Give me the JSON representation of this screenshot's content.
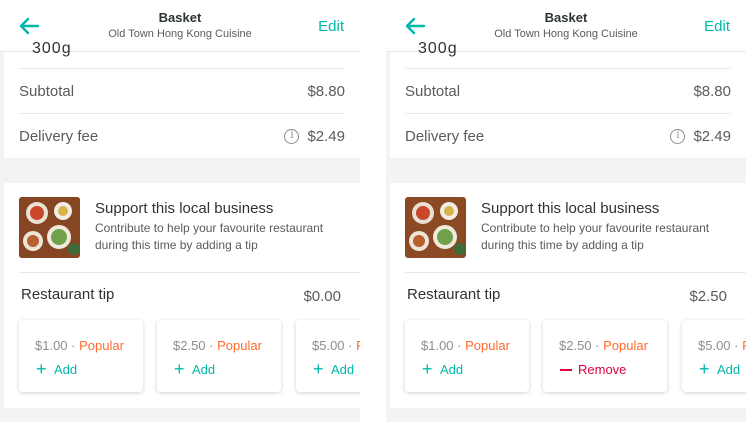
{
  "screens": [
    {
      "header": {
        "title": "Basket",
        "subtitle": "Old Town Hong Kong Cuisine",
        "edit_label": "Edit"
      },
      "summary": {
        "cutoff_text": "300g",
        "subtotal_label": "Subtotal",
        "subtotal_value": "$8.80",
        "delivery_label": "Delivery fee",
        "delivery_value": "$2.49",
        "info_icon": "i"
      },
      "support": {
        "title": "Support this local business",
        "description": "Contribute to help your favourite restaurant during this time by adding a tip",
        "tip_label": "Restaurant tip",
        "tip_amount": "$0.00",
        "options": [
          {
            "price": "$1.00 · ",
            "popular": "Popular",
            "action": "Add",
            "state": "add"
          },
          {
            "price": "$2.50 · ",
            "popular": "Popular",
            "action": "Add",
            "state": "add"
          },
          {
            "price": "$5.00 · ",
            "popular": "P",
            "action": "Add",
            "state": "add"
          }
        ]
      }
    },
    {
      "header": {
        "title": "Basket",
        "subtitle": "Old Town Hong Kong Cuisine",
        "edit_label": "Edit"
      },
      "summary": {
        "cutoff_text": "300g",
        "subtotal_label": "Subtotal",
        "subtotal_value": "$8.80",
        "delivery_label": "Delivery fee",
        "delivery_value": "$2.49",
        "info_icon": "i"
      },
      "support": {
        "title": "Support this local business",
        "description": "Contribute to help your favourite restaurant during this time by adding a tip",
        "tip_label": "Restaurant tip",
        "tip_amount": "$2.50",
        "options": [
          {
            "price": "$1.00 · ",
            "popular": "Popular",
            "action": "Add",
            "state": "add"
          },
          {
            "price": "$2.50 · ",
            "popular": "Popular",
            "action": "Remove",
            "state": "remove"
          },
          {
            "price": "$5.00 · ",
            "popular": "P",
            "action": "Add",
            "state": "add"
          }
        ]
      }
    }
  ],
  "colors": {
    "teal": "#00b8a9",
    "popular_orange": "#ff6a2c",
    "remove_red": "#e00040"
  }
}
